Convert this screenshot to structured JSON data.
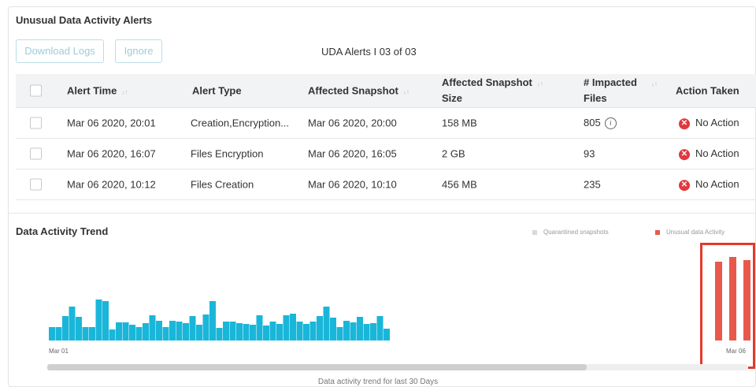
{
  "panel": {
    "title": "Unusual Data Activity Alerts",
    "download_label": "Download Logs",
    "ignore_label": "Ignore",
    "counter": "UDA Alerts I 03 of 03"
  },
  "table": {
    "headers": {
      "alert_time": "Alert Time",
      "alert_type": "Alert Type",
      "affected_snapshot": "Affected Snapshot",
      "snapshot_size_line1": "Affected Snapshot",
      "snapshot_size_line2": "Size",
      "impacted_line1": "# Impacted",
      "impacted_line2": "Files",
      "action": "Action Taken"
    },
    "rows": [
      {
        "time": "Mar 06 2020, 20:01",
        "type": "Creation,Encryption...",
        "snapshot": "Mar 06 2020, 20:00",
        "size": "158 MB",
        "files": "805",
        "action": "No Action"
      },
      {
        "time": "Mar 06 2020, 16:07",
        "type": "Files Encryption",
        "snapshot": "Mar 06 2020, 16:05",
        "size": "2 GB",
        "files": "93",
        "action": "No Action"
      },
      {
        "time": "Mar 06 2020, 10:12",
        "type": "Files Creation",
        "snapshot": "Mar 06 2020, 10:10",
        "size": "456 MB",
        "files": "235",
        "action": "No Action"
      }
    ]
  },
  "trend": {
    "title": "Data Activity Trend",
    "legend_quarantined": "Quarantined snapshots",
    "legend_unusual": "Unusual data Activity",
    "caption": "Data activity trend for last 30 Days",
    "colors": {
      "normal": "#1ab6d9",
      "unusual": "#e8594b",
      "quarantined": "#d9d9d9"
    }
  },
  "chart_data": {
    "type": "bar",
    "x_start_label": "Mar 01",
    "x_end_label": "Mar 06",
    "series": [
      {
        "name": "Quarantined snapshots",
        "values": []
      },
      {
        "name": "Unusual data Activity",
        "values": [
          0,
          0,
          0,
          0,
          0,
          0,
          0,
          0,
          0,
          0,
          0,
          0,
          0,
          0,
          0,
          0,
          0,
          0,
          0,
          0,
          0,
          0,
          0,
          0,
          0,
          0,
          0,
          0,
          0,
          0,
          0,
          0,
          0,
          0,
          0,
          0,
          0,
          0,
          0,
          0,
          0,
          0,
          0,
          0,
          0,
          0,
          0,
          0,
          0,
          0,
          0,
          100,
          106,
          102
        ]
      }
    ],
    "values": [
      17,
      17,
      31,
      43,
      30,
      17,
      17,
      52,
      50,
      14,
      23,
      23,
      20,
      17,
      22,
      32,
      25,
      17,
      25,
      24,
      22,
      31,
      20,
      33,
      50,
      16,
      24,
      24,
      22,
      21,
      20,
      32,
      19,
      24,
      21,
      32,
      34,
      24,
      21,
      24,
      31,
      43,
      29,
      17,
      25,
      23,
      30,
      21,
      22,
      31,
      15,
      0,
      0,
      0
    ]
  },
  "scrollbar": {
    "position_fraction": 0.77
  }
}
